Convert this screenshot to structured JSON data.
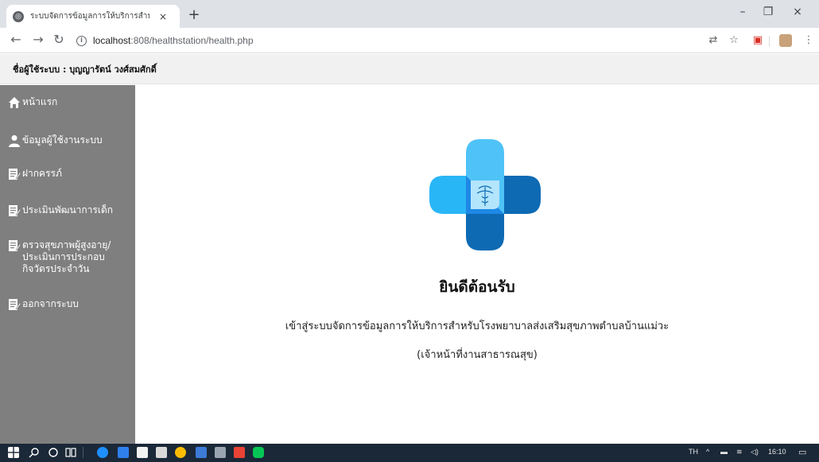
{
  "browser": {
    "tab_title": "ระบบจัดการข้อมูลการให้บริการสำหรับ",
    "tab_close": "×",
    "new_tab": "+",
    "url_host": "localhost",
    "url_rest": ":808/healthstation/health.php",
    "minimize": "–",
    "restore": "❐",
    "close": "×"
  },
  "header": {
    "user_label": "ชื่อผู้ใช้ระบบ : บุญญารัตน์ วงศ์สมศักดิ์"
  },
  "sidebar": {
    "items": [
      {
        "label": "หน้าแรก",
        "icon": "home-icon"
      },
      {
        "label": "ข้อมูลผู้ใช้งานระบบ",
        "icon": "user-icon"
      },
      {
        "label": "ฝากครรภ์",
        "icon": "edit-icon"
      },
      {
        "label": "ประเมินพัฒนาการเด็ก",
        "icon": "edit-icon"
      },
      {
        "label": "ตรวจสุขภาพผู้สูงอายุ/ประเมินการประกอบกิจวัตรประจำวัน",
        "icon": "edit-icon"
      },
      {
        "label": "ออกจากระบบ",
        "icon": "edit-icon"
      }
    ]
  },
  "main": {
    "welcome": "ยินดีต้อนรับ",
    "subtitle": "เข้าสู่ระบบจัดการข้อมูลการให้บริการสำหรับโรงพยาบาลส่งเสริมสุขภาพตำบลบ้านแม่วะ",
    "subtitle2": "(เจ้าหน้าที่งานสาธารณสุข)"
  },
  "taskbar": {
    "lang": "TH",
    "time": "16:10"
  },
  "colors": {
    "sidebar_bg": "#7f7f7f",
    "logo_light": "#4fc3f7",
    "logo_dark": "#0d6ab3",
    "taskbar_bg": "#1b2838"
  }
}
